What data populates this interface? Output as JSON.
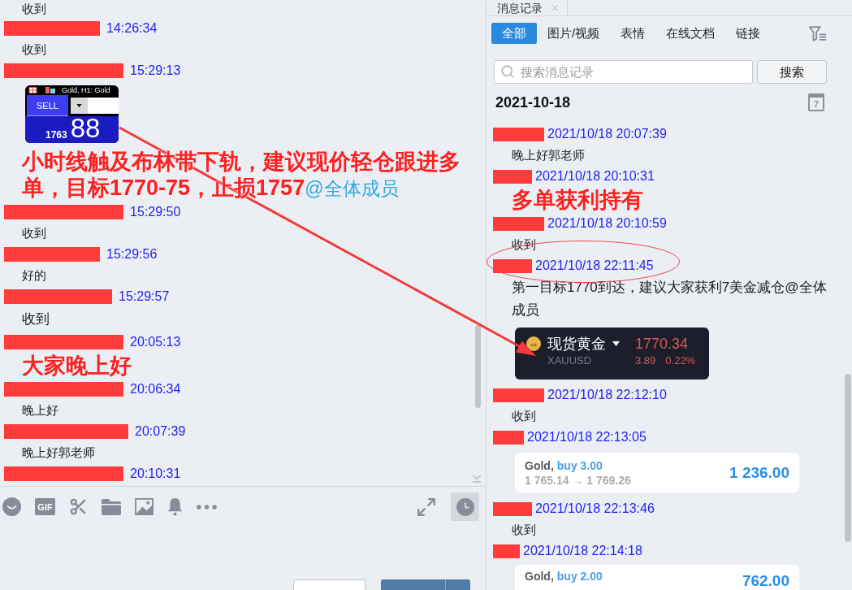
{
  "chat": {
    "messages": [
      {
        "kind": "text",
        "text": "收到"
      },
      {
        "kind": "header",
        "time": "14:26:34"
      },
      {
        "kind": "text",
        "text": "收到"
      },
      {
        "kind": "header",
        "time": "15:29:13"
      },
      {
        "kind": "image",
        "title": "Gold, H1: Gold",
        "sell_label": "SELL",
        "price_small": "1763",
        "price_large": "88"
      },
      {
        "kind": "headline",
        "text": "小时线触及布林带下轨，建议现价轻仓跟进多单，目标1770-75，止损1757",
        "mention": "@全体成员"
      },
      {
        "kind": "header",
        "time": "15:29:50"
      },
      {
        "kind": "text",
        "text": "收到"
      },
      {
        "kind": "header",
        "time": "15:29:56"
      },
      {
        "kind": "text",
        "text": "好的"
      },
      {
        "kind": "header",
        "time": "15:29:57"
      },
      {
        "kind": "large_text",
        "text": "收到"
      },
      {
        "kind": "header",
        "time": "20:05:13"
      },
      {
        "kind": "headline",
        "text": "大家晚上好"
      },
      {
        "kind": "header",
        "time": "20:06:34"
      },
      {
        "kind": "text",
        "text": "晚上好"
      },
      {
        "kind": "header",
        "time": "20:07:39"
      },
      {
        "kind": "text",
        "text": "晚上好郭老师"
      },
      {
        "kind": "header",
        "time": "20:10:31"
      }
    ]
  },
  "toolbar": {
    "gif_label": "GIF",
    "history_active": true
  },
  "history": {
    "tab": {
      "title": "消息记录"
    },
    "filters": [
      {
        "label": "全部",
        "selected": true
      },
      {
        "label": "图片/视频",
        "selected": false
      },
      {
        "label": "表情",
        "selected": false
      },
      {
        "label": "在线文档",
        "selected": false
      },
      {
        "label": "链接",
        "selected": false
      }
    ],
    "search": {
      "placeholder": "搜索消息记录",
      "button": "搜索"
    },
    "date": "2021-10-18",
    "calendar_day": "7",
    "messages": [
      {
        "kind": "header",
        "time": "2021/10/18 20:07:39",
        "circled": false
      },
      {
        "kind": "text",
        "text": "晚上好郭老师"
      },
      {
        "kind": "header",
        "time": "2021/10/18 20:10:31",
        "circled": false
      },
      {
        "kind": "headline",
        "text": "多单获利持有"
      },
      {
        "kind": "header",
        "time": "2021/10/18 20:10:59",
        "circled": false
      },
      {
        "kind": "text",
        "text": "收到"
      },
      {
        "kind": "header",
        "time": "2021/10/18 22:11:45",
        "circled": true
      },
      {
        "kind": "paragraph",
        "text": "第一目标1770到达，建议大家获利7美金减仓@全体成员"
      },
      {
        "kind": "quote_card",
        "name": "现货黄金",
        "symbol": "XAUUSD",
        "price": "1770.34",
        "change": "3.89",
        "percent": "0.22%"
      },
      {
        "kind": "header",
        "time": "2021/10/18 22:12:10",
        "circled": false
      },
      {
        "kind": "text",
        "text": "收到"
      },
      {
        "kind": "header",
        "time": "2021/10/18 22:13:05",
        "circled": false
      },
      {
        "kind": "trade_card",
        "instrument": "Gold,",
        "side": "buy 3.00",
        "route": "1 765.14 → 1 769.26",
        "amount": "1 236.00"
      },
      {
        "kind": "header",
        "time": "2021/10/18 22:13:46",
        "circled": false
      },
      {
        "kind": "text",
        "text": "收到"
      },
      {
        "kind": "header",
        "time": "2021/10/18 22:14:18",
        "circled": false
      },
      {
        "kind": "trade_card",
        "instrument": "Gold,",
        "side": "buy 2.00",
        "amount": "762.00"
      }
    ]
  }
}
